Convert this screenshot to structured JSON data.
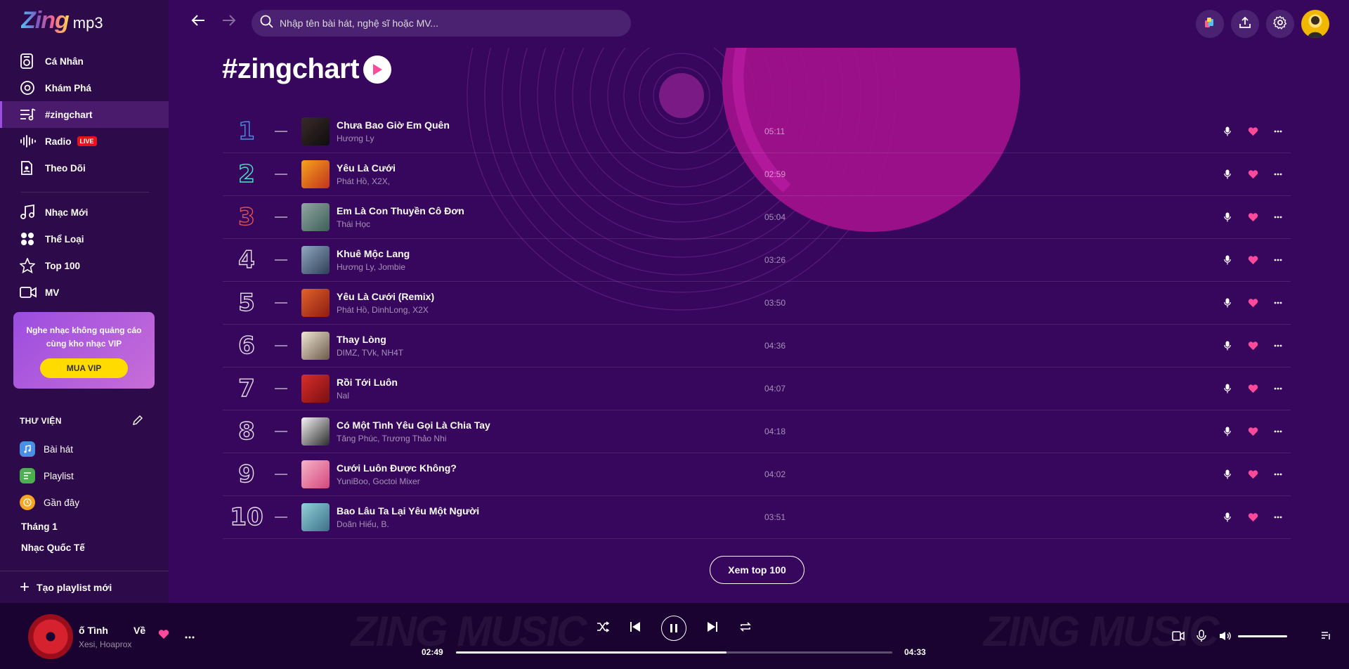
{
  "logo": {
    "brand": "Zing",
    "suffix": "mp3"
  },
  "sidebar": {
    "items": [
      {
        "label": "Cá Nhân",
        "icon": "library-icon"
      },
      {
        "label": "Khám Phá",
        "icon": "disc-icon"
      },
      {
        "label": "#zingchart",
        "icon": "chart-icon",
        "active": true
      },
      {
        "label": "Radio",
        "icon": "radio-icon",
        "badge": "LIVE"
      },
      {
        "label": "Theo Dõi",
        "icon": "follow-icon"
      },
      {
        "label": "Nhạc Mới",
        "icon": "music-note-icon"
      },
      {
        "label": "Thể Loại",
        "icon": "category-icon"
      },
      {
        "label": "Top 100",
        "icon": "star-icon"
      },
      {
        "label": "MV",
        "icon": "video-icon"
      }
    ],
    "vip": {
      "text": "Nghe nhạc không quảng cáo cùng kho nhạc VIP",
      "button": "MUA VIP"
    },
    "library": {
      "title": "THƯ VIỆN",
      "items": [
        {
          "label": "Bài hát",
          "color": "#4a90e2"
        },
        {
          "label": "Playlist",
          "color": "#4caf50"
        },
        {
          "label": "Gần đây",
          "color": "#f5a623"
        }
      ],
      "playlists": [
        "Tháng 1",
        "Nhạc Quốc Tế"
      ]
    },
    "new_playlist": "Tạo playlist mới"
  },
  "search": {
    "placeholder": "Nhập tên bài hát, nghệ sĩ hoặc MV..."
  },
  "chart": {
    "title": "#zingchart",
    "rows": [
      {
        "rank": "1",
        "title": "Chưa Bao Giờ Em Quên",
        "artist": "Hương Ly",
        "duration": "05:11",
        "thumb": [
          "#3b2a2a",
          "#0d0d0d"
        ]
      },
      {
        "rank": "2",
        "title": "Yêu Là Cưới",
        "artist": "Phát Hồ, X2X,",
        "duration": "02:59",
        "thumb": [
          "#f6a21b",
          "#c2331d"
        ]
      },
      {
        "rank": "3",
        "title": "Em Là Con Thuyền Cô Đơn",
        "artist": "Thái Học",
        "duration": "05:04",
        "thumb": [
          "#8fa7a0",
          "#3e5e58"
        ]
      },
      {
        "rank": "4",
        "title": "Khuê Mộc Lang",
        "artist": "Hương Ly, Jombie",
        "duration": "03:26",
        "thumb": [
          "#90a8c0",
          "#2e3f57"
        ]
      },
      {
        "rank": "5",
        "title": "Yêu Là Cưới (Remix)",
        "artist": "Phát Hồ, DinhLong, X2X",
        "duration": "03:50",
        "thumb": [
          "#e0622a",
          "#8e1b12"
        ]
      },
      {
        "rank": "6",
        "title": "Thay Lòng",
        "artist": "DIMZ, TVk, NH4T",
        "duration": "04:36",
        "thumb": [
          "#efe6d3",
          "#6b5a48"
        ]
      },
      {
        "rank": "7",
        "title": "Rồi Tới Luôn",
        "artist": "Nal",
        "duration": "04:07",
        "thumb": [
          "#d92d2a",
          "#7a0f12"
        ]
      },
      {
        "rank": "8",
        "title": "Có Một Tình Yêu Gọi Là Chia Tay",
        "artist": "Tăng Phúc, Trương Thảo Nhi",
        "duration": "04:18",
        "thumb": [
          "#f4f4f4",
          "#2b2b2b"
        ]
      },
      {
        "rank": "9",
        "title": "Cưới Luôn Được Không?",
        "artist": "YuniBoo, Goctoi Mixer",
        "duration": "04:02",
        "thumb": [
          "#f7b3c9",
          "#d4477c"
        ]
      },
      {
        "rank": "10",
        "title": "Bao Lâu Ta Lại Yêu Một Người",
        "artist": "Doãn Hiếu, B.",
        "duration": "03:51",
        "thumb": [
          "#8fd2d8",
          "#3d6f89"
        ]
      }
    ],
    "more_button": "Xem top 100"
  },
  "player": {
    "title": "ố Tình",
    "title_extra": "Về",
    "artist": "Xesi, Hoaprox",
    "current": "02:49",
    "total": "04:33",
    "progress": 0.62,
    "bg_word": "ZING MUSIC"
  },
  "colors": {
    "accent": "#9b4de0",
    "heart": "#ff4a9c",
    "vip_button": "#ffdb00",
    "bg": "#37075d"
  }
}
